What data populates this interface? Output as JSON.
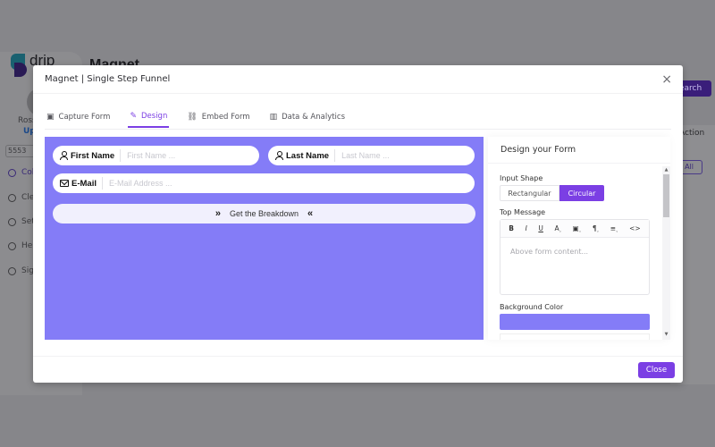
{
  "background": {
    "logo_text": "drip",
    "page_title": "Magnet",
    "user_name": "Ross",
    "upgrade_label": "Up",
    "phone": "5553",
    "nav": [
      {
        "label": "Col",
        "icon": "collection-icon",
        "active": true
      },
      {
        "label": "Cle",
        "icon": "bell-icon",
        "active": false
      },
      {
        "label": "Set",
        "icon": "gear-icon",
        "active": false
      },
      {
        "label": "Hel",
        "icon": "help-icon",
        "active": false
      },
      {
        "label": "Sig",
        "icon": "signout-icon",
        "active": false
      }
    ],
    "search_label": "earch",
    "action_label": "Action",
    "view_all_label": "w All"
  },
  "modal": {
    "title": "Magnet | Single Step Funnel",
    "close_icon": "×",
    "tabs": [
      {
        "label": "Capture Form",
        "icon": "form-icon",
        "glyph": "▣",
        "active": false
      },
      {
        "label": "Design",
        "icon": "brush-icon",
        "glyph": "✎",
        "active": true
      },
      {
        "label": "Embed Form",
        "icon": "link-icon",
        "glyph": "🔗",
        "active": false
      },
      {
        "label": "Data & Analytics",
        "icon": "chart-icon",
        "glyph": "▥",
        "active": false
      }
    ],
    "preview": {
      "first_name_label": "First Name",
      "first_name_placeholder": "First Name ...",
      "last_name_label": "Last Name",
      "last_name_placeholder": "Last Name ...",
      "email_label": "E-Mail",
      "email_placeholder": "E-Mail Address ...",
      "submit_label": "Get the Breakdown",
      "submit_left_glyph": "»",
      "submit_right_glyph": "«"
    },
    "design": {
      "heading": "Design your Form",
      "input_shape_label": "Input Shape",
      "shape_options": [
        "Rectangular",
        "Circular"
      ],
      "shape_selected": "Circular",
      "top_message_label": "Top Message",
      "toolbar": [
        "B",
        "I",
        "U",
        "A˯",
        "🅰˯",
        "¶˯",
        "≡˯",
        "<>"
      ],
      "top_message_placeholder": "Above form content...",
      "background_color_label": "Background Color",
      "background_color": "#847cf7"
    },
    "close_button_label": "Close"
  },
  "colors": {
    "accent": "#7b3fe4",
    "preview_bg": "#847cf7",
    "overlay": "#86868a"
  }
}
